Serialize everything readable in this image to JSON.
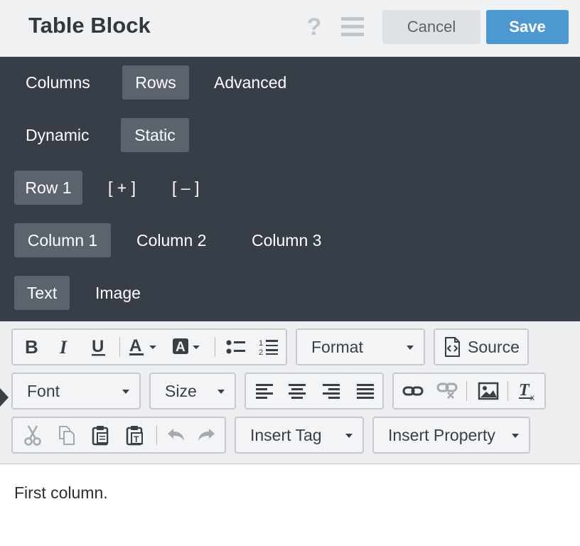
{
  "header": {
    "title": "Table Block",
    "help_icon": "question-icon",
    "menu_icon": "hamburger-menu-icon",
    "cancel_label": "Cancel",
    "save_label": "Save",
    "save_color": "#4d98d1"
  },
  "tabs": {
    "main": [
      {
        "label": "Columns",
        "active": false
      },
      {
        "label": "Rows",
        "active": true
      },
      {
        "label": "Advanced",
        "active": false
      }
    ],
    "mode": [
      {
        "label": "Dynamic",
        "active": false
      },
      {
        "label": "Static",
        "active": true
      }
    ],
    "rows": [
      {
        "label": "Row 1",
        "active": true
      },
      {
        "label": "[ + ]",
        "active": false
      },
      {
        "label": "[ – ]",
        "active": false
      }
    ],
    "columns": [
      {
        "label": "Column 1",
        "active": true
      },
      {
        "label": "Column 2",
        "active": false
      },
      {
        "label": "Column 3",
        "active": false
      }
    ],
    "content_type": [
      {
        "label": "Text",
        "active": true
      },
      {
        "label": "Image",
        "active": false
      }
    ]
  },
  "toolbar": {
    "format_label": "Format",
    "source_label": "Source",
    "font_label": "Font",
    "size_label": "Size",
    "insert_tag_label": "Insert Tag",
    "insert_property_label": "Insert Property",
    "icons": [
      "bold-icon",
      "italic-icon",
      "underline-icon",
      "text-color-icon",
      "background-color-icon",
      "bulleted-list-icon",
      "numbered-list-icon",
      "source-icon",
      "align-left-icon",
      "align-center-icon",
      "align-right-icon",
      "justify-icon",
      "link-icon",
      "unlink-icon",
      "image-icon",
      "remove-format-icon",
      "cut-icon",
      "copy-icon",
      "paste-icon",
      "paste-text-icon",
      "undo-icon",
      "redo-icon"
    ]
  },
  "editor": {
    "content": "First column."
  }
}
